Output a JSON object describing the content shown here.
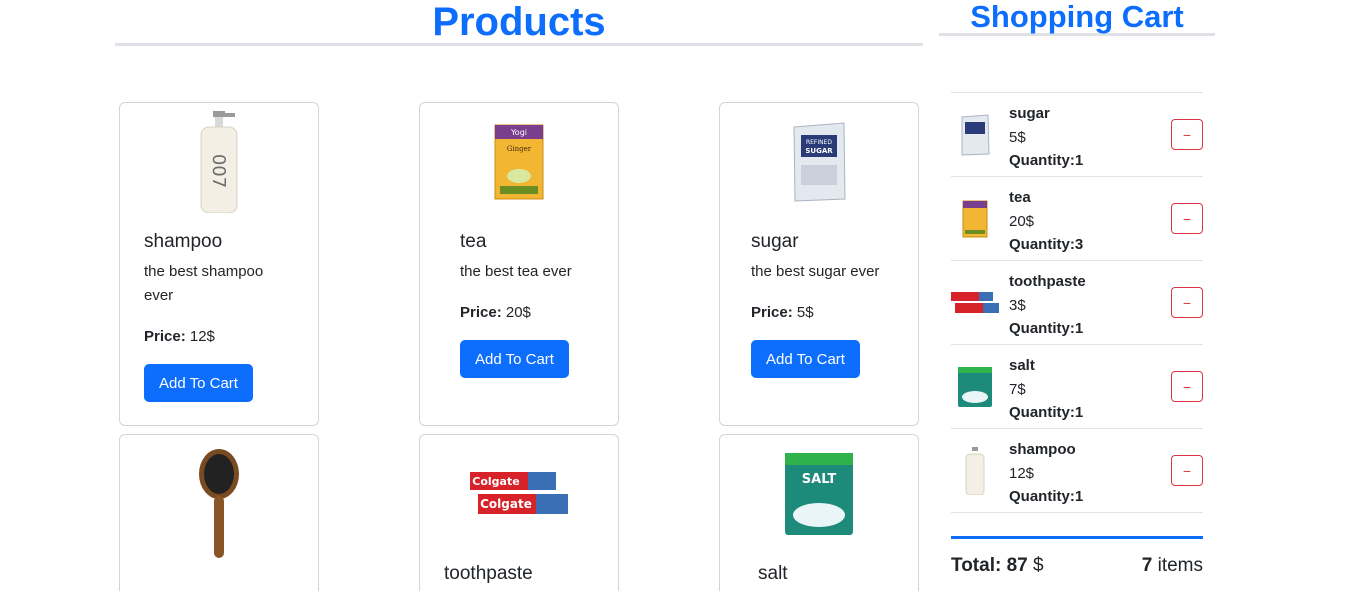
{
  "products": {
    "title": "Products",
    "add_label": "Add To Cart",
    "price_label": "Price:",
    "items": [
      {
        "name": "shampoo",
        "desc": "the best shampoo ever",
        "price": "12$"
      },
      {
        "name": "tea",
        "desc": "the best tea ever",
        "price": "20$"
      },
      {
        "name": "sugar",
        "desc": "the best sugar ever",
        "price": "5$"
      },
      {
        "name": "",
        "desc": "",
        "price": ""
      },
      {
        "name": "toothpaste",
        "desc": "",
        "price": ""
      },
      {
        "name": "salt",
        "desc": "",
        "price": ""
      }
    ]
  },
  "cart": {
    "title": "Shopping Cart",
    "remove_label": "−",
    "items": [
      {
        "name": "sugar",
        "price": "5$",
        "qty": "Quantity:1"
      },
      {
        "name": "tea",
        "price": "20$",
        "qty": "Quantity:3"
      },
      {
        "name": "toothpaste",
        "price": "3$",
        "qty": "Quantity:1"
      },
      {
        "name": "salt",
        "price": "7$",
        "qty": "Quantity:1"
      },
      {
        "name": "shampoo",
        "price": "12$",
        "qty": "Quantity:1"
      }
    ],
    "total_label": "Total:",
    "total_value": "87",
    "currency": "$",
    "item_count": "7",
    "items_label": "items"
  },
  "colors": {
    "primary": "#0d6efd",
    "danger": "#dc3545",
    "border": "#dee2e6"
  }
}
